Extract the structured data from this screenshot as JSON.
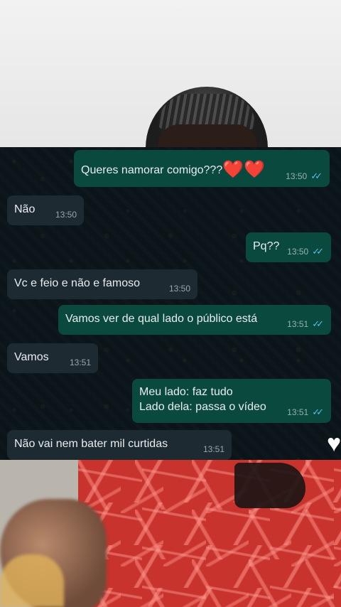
{
  "chat": {
    "messages": [
      {
        "id": "m1",
        "direction": "outgoing",
        "text": "Queres namorar comigo???",
        "hearts": "❤️❤️",
        "time": "13:50",
        "status": "read"
      },
      {
        "id": "m2",
        "direction": "incoming",
        "text": "Não",
        "time": "13:50"
      },
      {
        "id": "m3",
        "direction": "outgoing",
        "text": "Pq??",
        "time": "13:50",
        "status": "read"
      },
      {
        "id": "m4",
        "direction": "incoming",
        "text": "Vc e feio e não e famoso",
        "time": "13:50"
      },
      {
        "id": "m5",
        "direction": "outgoing",
        "text": "Vamos ver de qual lado o público está",
        "time": "13:51",
        "status": "read"
      },
      {
        "id": "m6",
        "direction": "incoming",
        "text": "Vamos",
        "time": "13:51"
      },
      {
        "id": "m7",
        "direction": "outgoing",
        "line1": "Meu lado: faz tudo",
        "line2": "Lado dela: passa o vídeo",
        "time": "13:51",
        "status": "read"
      },
      {
        "id": "m8",
        "direction": "incoming",
        "text": "Não vai nem bater mil curtidas",
        "time": "13:51"
      }
    ],
    "read_tick": "✓✓"
  },
  "colors": {
    "outgoing_bubble": "#0a4a3e",
    "incoming_bubble": "#1e2a31",
    "chat_background": "#0b1418",
    "read_tick": "#53bdeb"
  },
  "icons": {
    "like": "heart-icon"
  }
}
